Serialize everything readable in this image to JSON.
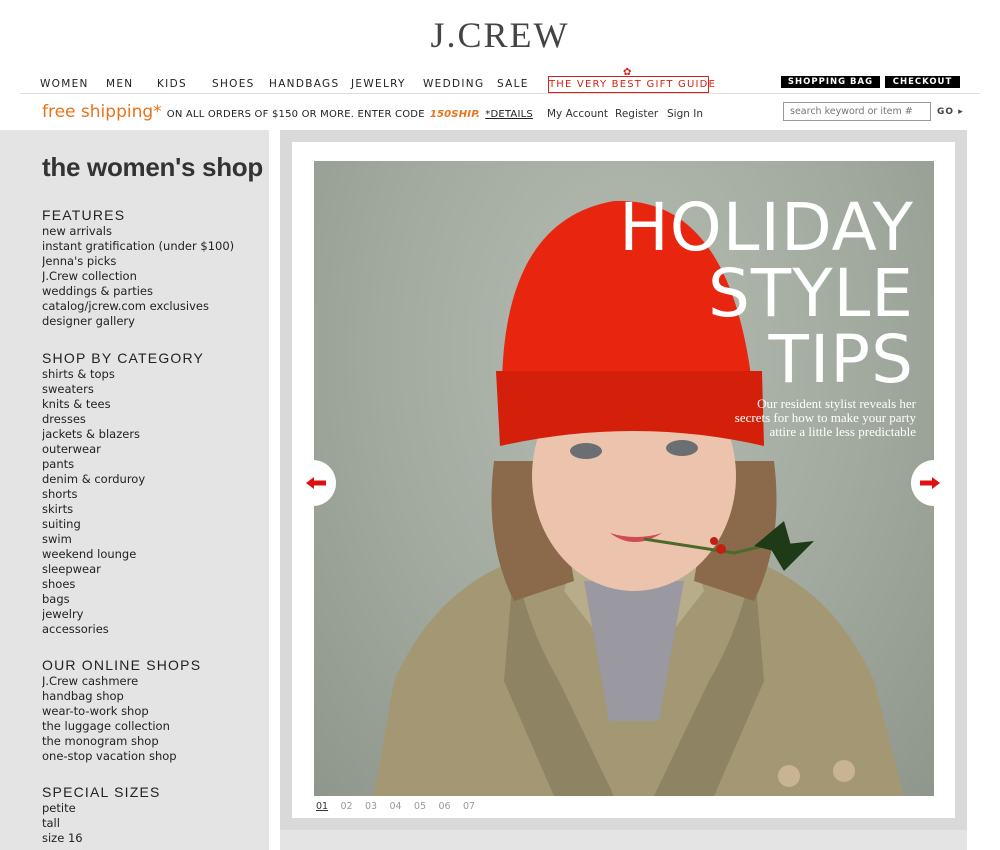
{
  "header": {
    "logo": "J.CREW",
    "nav": [
      "WOMEN",
      "MEN",
      "KIDS",
      "SHOES",
      "HANDBAGS",
      "JEWELRY",
      "WEDDING",
      "SALE"
    ],
    "gift_guide": "THE VERY BEST GIFT GUIDE",
    "shopping_bag": "SHOPPING BAG",
    "checkout": "CHECKOUT"
  },
  "promo": {
    "free_shipping": "free shipping*",
    "terms": "ON ALL ORDERS OF $150 OR MORE. ENTER CODE",
    "code": "150SHIP.",
    "details": "*DETAILS"
  },
  "account": {
    "my_account": "My Account",
    "register": "Register",
    "sign_in": "Sign In"
  },
  "search": {
    "placeholder": "search keyword or item #",
    "go": "GO"
  },
  "sidebar": {
    "title": "the women's shop",
    "features": {
      "heading": "FEATURES",
      "items": [
        "new arrivals",
        "instant gratification (under $100)",
        "Jenna's picks",
        "J.Crew collection",
        "weddings & parties",
        "catalog/jcrew.com exclusives",
        "designer gallery"
      ]
    },
    "category": {
      "heading": "SHOP BY CATEGORY",
      "items": [
        "shirts & tops",
        "sweaters",
        "knits & tees",
        "dresses",
        "jackets & blazers",
        "outerwear",
        "pants",
        "denim & corduroy",
        "shorts",
        "skirts",
        "suiting",
        "swim",
        "weekend lounge",
        "sleepwear",
        "shoes",
        "bags",
        "jewelry",
        "accessories"
      ]
    },
    "online_shops": {
      "heading": "OUR ONLINE SHOPS",
      "items": [
        "J.Crew cashmere",
        "handbag shop",
        "wear-to-work shop",
        "the luggage collection",
        "the monogram shop",
        "one-stop vacation shop"
      ]
    },
    "special_sizes": {
      "heading": "SPECIAL SIZES",
      "items": [
        "petite",
        "tall",
        "size 16"
      ]
    }
  },
  "hero": {
    "title_lines": [
      "HOLIDAY",
      "STYLE",
      "TIPS"
    ],
    "subtitle_lines": [
      "Our resident stylist reveals her",
      "secrets for how to make your party",
      "attire a little less predictable"
    ],
    "pages": [
      "01",
      "02",
      "03",
      "04",
      "05",
      "06",
      "07"
    ],
    "active_page": "01"
  },
  "colors": {
    "accent_orange": "#e8731a",
    "gift_red": "#d62018",
    "arrow_red": "#e01010",
    "hat_red": "#e8260f"
  }
}
